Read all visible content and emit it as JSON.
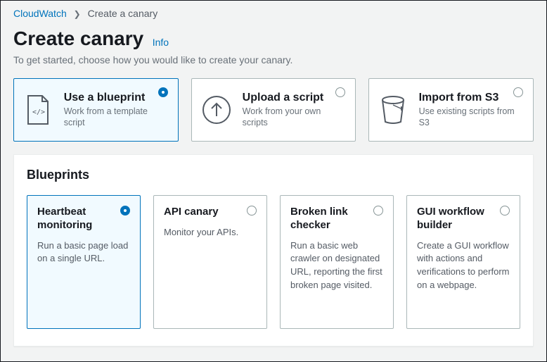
{
  "breadcrumb": {
    "root": "CloudWatch",
    "current": "Create a canary"
  },
  "header": {
    "title": "Create canary",
    "info": "Info",
    "subtitle": "To get started, choose how you would like to create your canary."
  },
  "methods": [
    {
      "title": "Use a blueprint",
      "desc": "Work from a template script",
      "selected": true
    },
    {
      "title": "Upload a script",
      "desc": "Work from your own scripts",
      "selected": false
    },
    {
      "title": "Import from S3",
      "desc": "Use existing scripts from S3",
      "selected": false
    }
  ],
  "panel": {
    "heading": "Blueprints"
  },
  "blueprints": [
    {
      "title": "Heartbeat monitoring",
      "desc": "Run a basic page load on a single URL.",
      "selected": true
    },
    {
      "title": "API canary",
      "desc": "Monitor your APIs.",
      "selected": false
    },
    {
      "title": "Broken link checker",
      "desc": "Run a basic web crawler on designated URL, reporting the first broken page visited.",
      "selected": false
    },
    {
      "title": "GUI workflow builder",
      "desc": "Create a GUI workflow with actions and verifications to perform on a webpage.",
      "selected": false
    }
  ]
}
